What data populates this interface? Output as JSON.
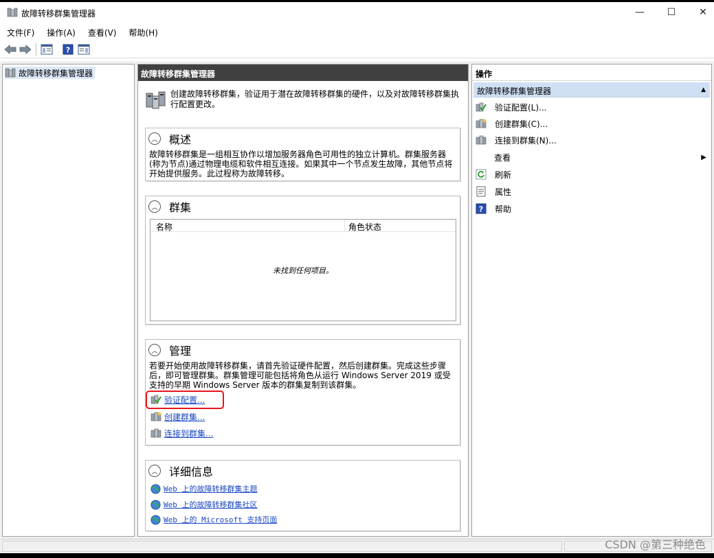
{
  "window": {
    "title": "故障转移群集管理器",
    "controls": {
      "minimize": "—",
      "maximize": "☐",
      "close": "✕"
    }
  },
  "menu": [
    "文件(F)",
    "操作(A)",
    "查看(V)",
    "帮助(H)"
  ],
  "toolbar": {
    "back_icon": "back-arrow-icon",
    "forward_icon": "forward-arrow-icon",
    "show_tree_icon": "console-tree-icon",
    "help_icon": "help-icon",
    "show_action_icon": "action-pane-icon"
  },
  "tree": {
    "root_label": "故障转移群集管理器"
  },
  "center": {
    "header": "故障转移群集管理器",
    "intro": "创建故障转移群集，验证用于潜在故障转移群集的硬件，以及对故障转移群集执行配置更改。",
    "overview": {
      "title": "概述",
      "text": "故障转移群集是一组相互协作以增加服务器角色可用性的独立计算机。群集服务器(称为节点)通过物理电缆和软件相互连接。如果其中一个节点发生故障，其他节点将开始提供服务。此过程称为故障转移。"
    },
    "clusters": {
      "title": "群集",
      "col_name": "名称",
      "col_role_status": "角色状态",
      "empty_text": "未找到任何项目。"
    },
    "management": {
      "title": "管理",
      "text": "若要开始使用故障转移群集，请首先验证硬件配置，然后创建群集。完成这些步骤后，即可管理群集。群集管理可能包括将角色从运行 Windows Server 2019 或受支持的早期 Windows Server 版本的群集复制到该群集。",
      "links": [
        "验证配置...",
        "创建群集...",
        "连接到群集..."
      ]
    },
    "more_info": {
      "title": "详细信息",
      "links": [
        "Web 上的故障转移群集主题",
        "Web 上的故障转移群集社区",
        "Web 上的 Microsoft 支持页面"
      ]
    }
  },
  "actions": {
    "header": "操作",
    "subheader": "故障转移群集管理器",
    "items": [
      "验证配置(L)...",
      "创建群集(C)...",
      "连接到群集(N)...",
      "查看",
      "刷新",
      "属性",
      "帮助"
    ]
  },
  "watermark": "CSDN @第三种绝色"
}
